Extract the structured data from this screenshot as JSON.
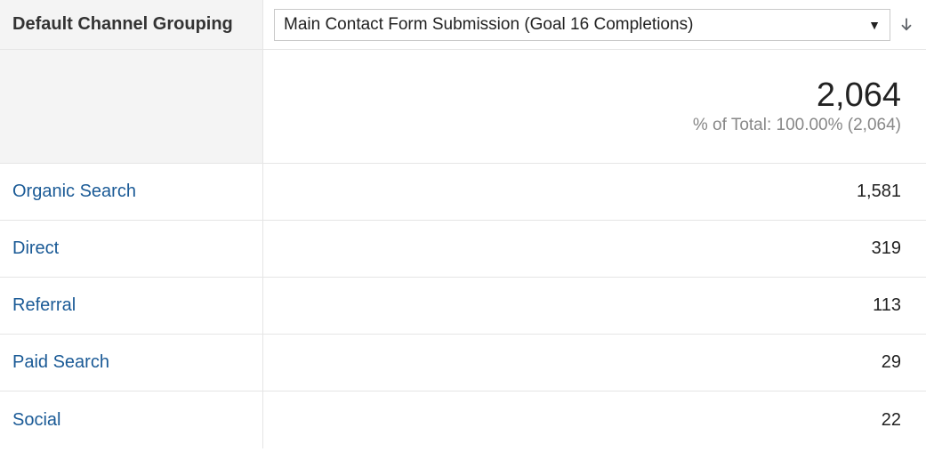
{
  "header": {
    "dimension_label": "Default Channel Grouping",
    "metric_selected": "Main Contact Form Submission (Goal 16 Completions)"
  },
  "summary": {
    "total": "2,064",
    "subtext": "% of Total: 100.00% (2,064)"
  },
  "rows": [
    {
      "label": "Organic Search",
      "value": "1,581"
    },
    {
      "label": "Direct",
      "value": "319"
    },
    {
      "label": "Referral",
      "value": "113"
    },
    {
      "label": "Paid Search",
      "value": "29"
    },
    {
      "label": "Social",
      "value": "22"
    }
  ],
  "chart_data": {
    "type": "table",
    "title": "Main Contact Form Submission (Goal 16 Completions) by Default Channel Grouping",
    "categories": [
      "Organic Search",
      "Direct",
      "Referral",
      "Paid Search",
      "Social"
    ],
    "values": [
      1581,
      319,
      113,
      29,
      22
    ],
    "total": 2064,
    "percent_of_total": 100.0
  }
}
